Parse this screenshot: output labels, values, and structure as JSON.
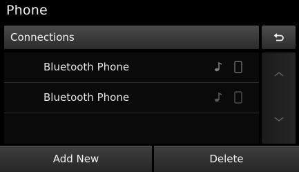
{
  "app": {
    "title": "Phone"
  },
  "header": {
    "label": "Connections",
    "back_icon": "return-arrow-icon"
  },
  "devices": [
    {
      "name": "Bluetooth Phone",
      "icons": [
        "audio-note-icon",
        "phone-handset-icon"
      ]
    },
    {
      "name": "Bluetooth Phone",
      "icons": [
        "audio-note-icon",
        "phone-handset-icon"
      ]
    }
  ],
  "scroll": {
    "up_icon": "chevron-up-icon",
    "down_icon": "chevron-down-icon"
  },
  "footer": {
    "add_label": "Add New",
    "delete_label": "Delete"
  }
}
